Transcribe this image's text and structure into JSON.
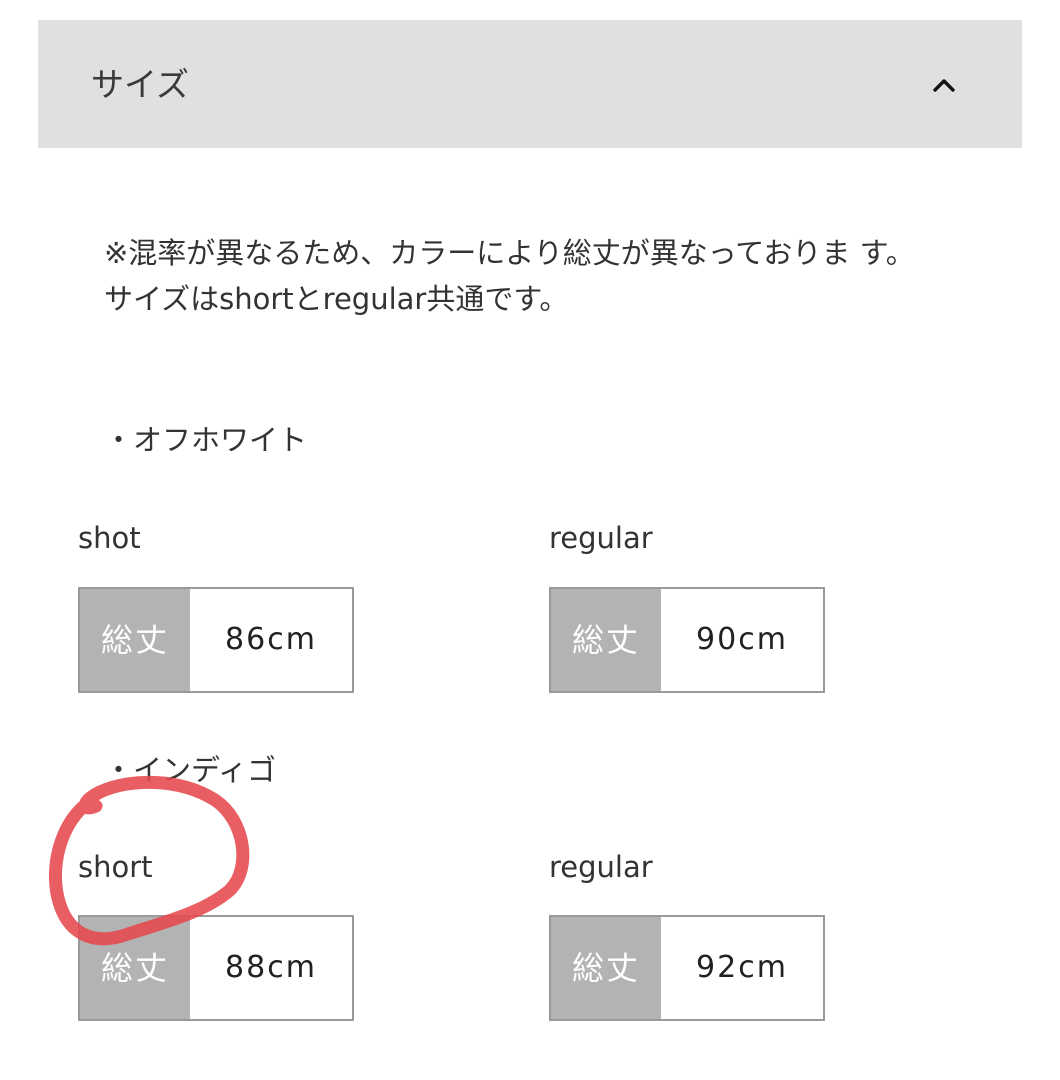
{
  "accordion": {
    "title": "サイズ",
    "toggle_icon": "chevron-up-icon"
  },
  "notes": {
    "line1": "※混率が異なるため、カラーにより総丈が異なっておりま す。",
    "line2": "サイズはshortとregular共通です。"
  },
  "colors": [
    {
      "name": "・オフホワイト",
      "variants": [
        {
          "label": "shot",
          "key": "総丈",
          "value": "86cm"
        },
        {
          "label": "regular",
          "key": "総丈",
          "value": "90cm"
        }
      ]
    },
    {
      "name": "・インディゴ",
      "variants": [
        {
          "label": "short",
          "key": "総丈",
          "value": "88cm"
        },
        {
          "label": "regular",
          "key": "総丈",
          "value": "92cm"
        }
      ]
    }
  ],
  "annotation": {
    "color": "#e5484d",
    "marks": "short"
  }
}
